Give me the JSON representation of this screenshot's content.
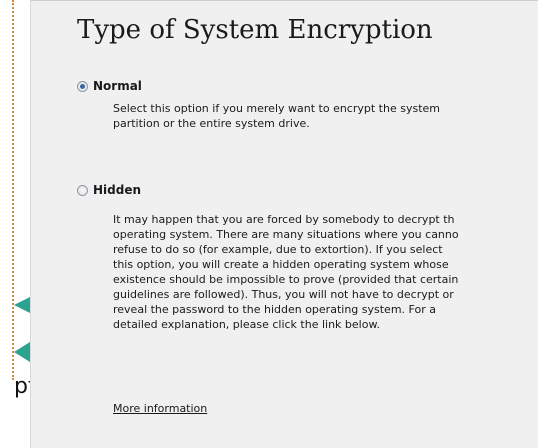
{
  "left_banner": {
    "partial_text": "pt"
  },
  "page": {
    "title": "Type of System Encryption"
  },
  "options": [
    {
      "label": "Normal",
      "selected": true,
      "description_lines": [
        "Select this option if you merely want to encrypt the system",
        "partition or the entire system drive."
      ]
    },
    {
      "label": "Hidden",
      "selected": false,
      "description_lines": [
        "It may happen that you are forced by somebody to decrypt th",
        "operating system. There are many situations where you canno",
        "refuse to do so (for example, due to extortion). If you select",
        "this option, you will create a hidden operating system whose",
        "existence should be impossible to prove (provided that certain",
        "guidelines are followed). Thus, you will not have to decrypt or",
        "reveal the password to the hidden operating system. For a",
        "detailed explanation, please click the link below."
      ]
    }
  ],
  "more_info_link": "More information",
  "colors": {
    "accent_teal": "#2aa391",
    "dotted_border": "#d88a3a",
    "radio_dot": "#3a67a8"
  }
}
